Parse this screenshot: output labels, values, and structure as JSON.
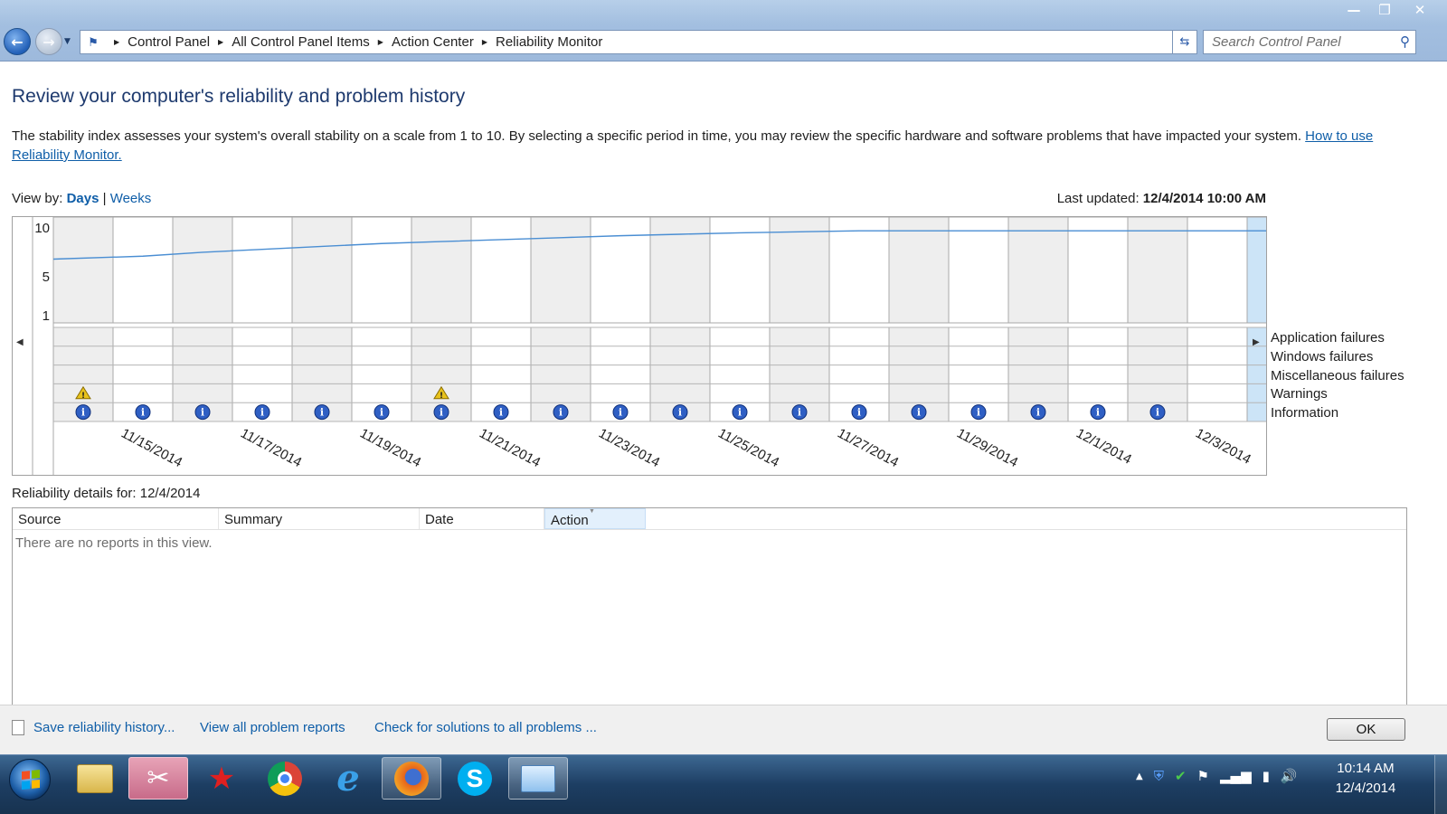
{
  "window": {
    "controls": {
      "minimize": "—",
      "restore": "❐",
      "close": "✕"
    }
  },
  "addressbar": {
    "breadcrumbs": [
      "Control Panel",
      "All Control Panel Items",
      "Action Center",
      "Reliability Monitor"
    ],
    "search_placeholder": "Search Control Panel"
  },
  "page": {
    "heading": "Review your computer's reliability and problem history",
    "description": "The stability index assesses your system's overall stability on a scale from 1 to 10. By selecting a specific period in time, you may review the specific hardware and software problems that have impacted your system.",
    "help_link": "How to use Reliability Monitor.",
    "view_by_label": "View by:",
    "view_days": "Days",
    "view_separator": "|",
    "view_weeks": "Weeks",
    "last_updated_label": "Last updated:",
    "last_updated_value": "12/4/2014 10:00 AM"
  },
  "chart_data": {
    "type": "line",
    "y_ticks": [
      "10",
      "5",
      "1"
    ],
    "ylim": [
      1,
      10
    ],
    "columns": [
      "11/14/2014",
      "11/15/2014",
      "11/16/2014",
      "11/17/2014",
      "11/18/2014",
      "11/19/2014",
      "11/20/2014",
      "11/21/2014",
      "11/22/2014",
      "11/23/2014",
      "11/24/2014",
      "11/25/2014",
      "11/26/2014",
      "11/27/2014",
      "11/28/2014",
      "11/29/2014",
      "11/30/2014",
      "12/1/2014",
      "12/2/2014",
      "12/3/2014",
      "12/4/2014"
    ],
    "date_labels": [
      "11/15/2014",
      "11/17/2014",
      "11/19/2014",
      "11/21/2014",
      "11/23/2014",
      "11/25/2014",
      "11/27/2014",
      "11/29/2014",
      "12/1/2014",
      "12/3/2014"
    ],
    "stability_index": [
      6.8,
      7.1,
      7.5,
      7.8,
      8.1,
      8.4,
      8.6,
      8.8,
      9.0,
      9.2,
      9.35,
      9.5,
      9.6,
      9.7,
      9.7,
      9.7,
      9.7,
      9.7,
      9.7,
      9.7,
      9.7
    ],
    "selected_column": "12/4/2014",
    "event_rows": [
      "Application failures",
      "Windows failures",
      "Miscellaneous failures",
      "Warnings",
      "Information"
    ],
    "warnings": [
      "11/14/2014",
      "11/20/2014"
    ],
    "information": [
      "11/14/2014",
      "11/15/2014",
      "11/16/2014",
      "11/17/2014",
      "11/18/2014",
      "11/19/2014",
      "11/20/2014",
      "11/21/2014",
      "11/22/2014",
      "11/23/2014",
      "11/24/2014",
      "11/25/2014",
      "11/26/2014",
      "11/27/2014",
      "11/28/2014",
      "11/29/2014",
      "11/30/2014",
      "12/1/2014",
      "12/2/2014"
    ],
    "colors": {
      "line": "#4a8ed3",
      "selected": "#cce4f7",
      "shaded": "#eeeeee",
      "info": "#2f5fc4",
      "warning": "#e8c21c"
    }
  },
  "details": {
    "title": "Reliability details for: 12/4/2014",
    "columns": [
      "Source",
      "Summary",
      "Date",
      "Action"
    ],
    "empty_message": "There are no reports in this view."
  },
  "bottom": {
    "save_history": "Save reliability history...",
    "view_all": "View all problem reports",
    "check_solutions": "Check for solutions to all problems ...",
    "ok": "OK"
  },
  "taskbar": {
    "apps": [
      "snipping-tool",
      "file-explorer",
      "pokerstars",
      "chrome",
      "internet-explorer",
      "firefox",
      "skype",
      "control-panel"
    ],
    "time": "10:14 AM",
    "date": "12/4/2014"
  }
}
